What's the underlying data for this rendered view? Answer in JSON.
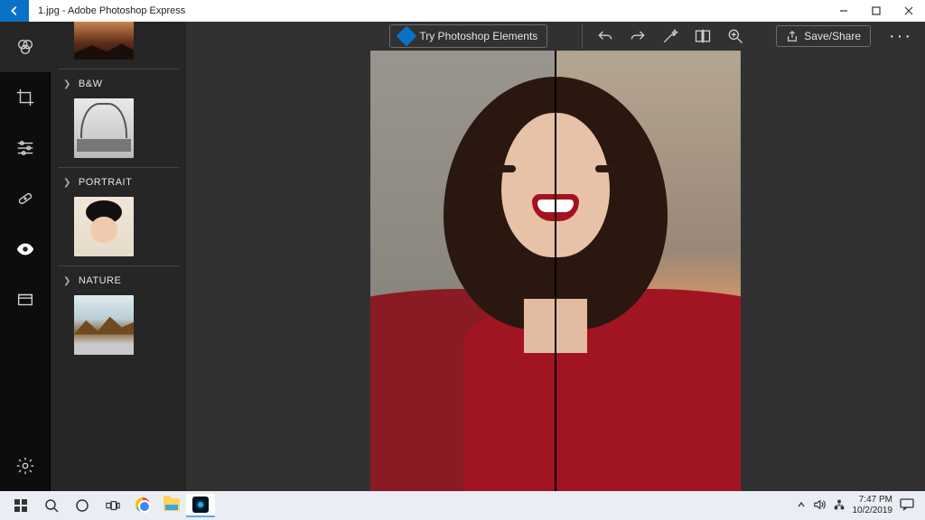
{
  "titlebar": {
    "title": "1.jpg - Adobe Photoshop Express"
  },
  "sidepanel": {
    "categories": [
      {
        "label": "B&W"
      },
      {
        "label": "PORTRAIT"
      },
      {
        "label": "NATURE"
      }
    ]
  },
  "toolbar": {
    "try_label": "Try Photoshop Elements",
    "save_label": "Save/Share"
  },
  "taskbar": {
    "time": "7:47 PM",
    "date": "10/2/2019"
  }
}
